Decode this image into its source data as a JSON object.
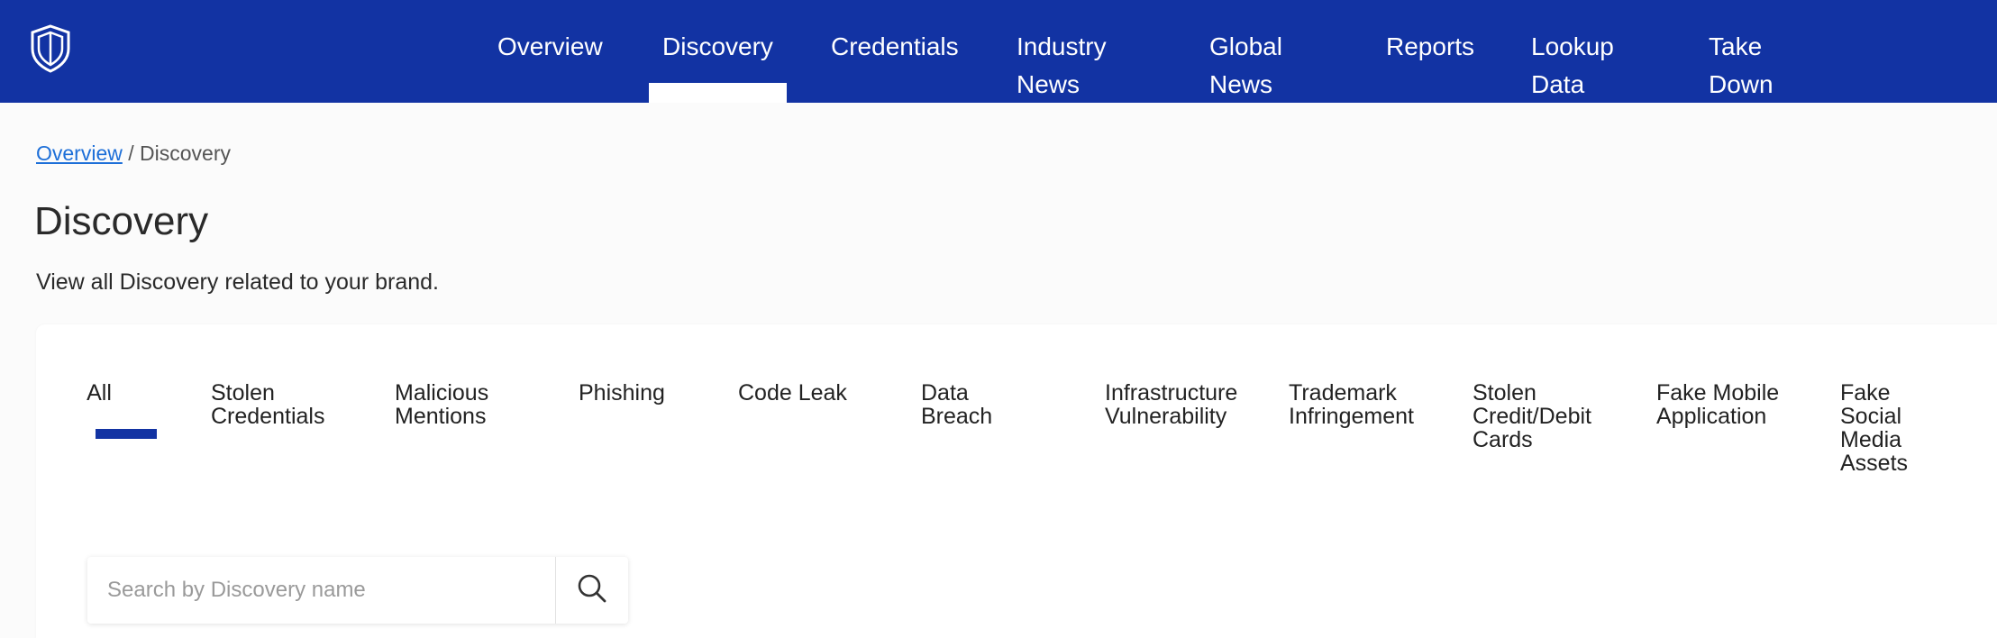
{
  "nav": {
    "logo_icon": "shield-icon",
    "items": [
      {
        "label": "Overview"
      },
      {
        "label": "Discovery",
        "active": true
      },
      {
        "label": "Credentials"
      },
      {
        "label": "Industry News"
      },
      {
        "label": "Global News"
      },
      {
        "label": "Reports"
      },
      {
        "label": "Lookup Data"
      },
      {
        "label": "Take Down"
      }
    ],
    "background_color": "#1233a3"
  },
  "breadcrumb": {
    "link": "Overview",
    "separator": " / ",
    "current": "Discovery"
  },
  "page": {
    "title": "Discovery",
    "subtitle": "View all Discovery related to your brand."
  },
  "tabs": [
    {
      "label": "All",
      "active": true
    },
    {
      "label": "Stolen Credentials"
    },
    {
      "label": "Malicious Mentions"
    },
    {
      "label": "Phishing"
    },
    {
      "label": "Code Leak"
    },
    {
      "label": "Data Breach"
    },
    {
      "label": "Infrastructure Vulnerability"
    },
    {
      "label": "Trademark Infringement"
    },
    {
      "label": "Stolen Credit/Debit Cards"
    },
    {
      "label": "Fake Mobile Application"
    },
    {
      "label": "Fake Social Media Assets"
    }
  ],
  "search": {
    "placeholder": "Search by Discovery name",
    "value": "",
    "icon": "search-icon"
  },
  "colors": {
    "accent": "#1233a3",
    "link": "#1d6fd8"
  }
}
